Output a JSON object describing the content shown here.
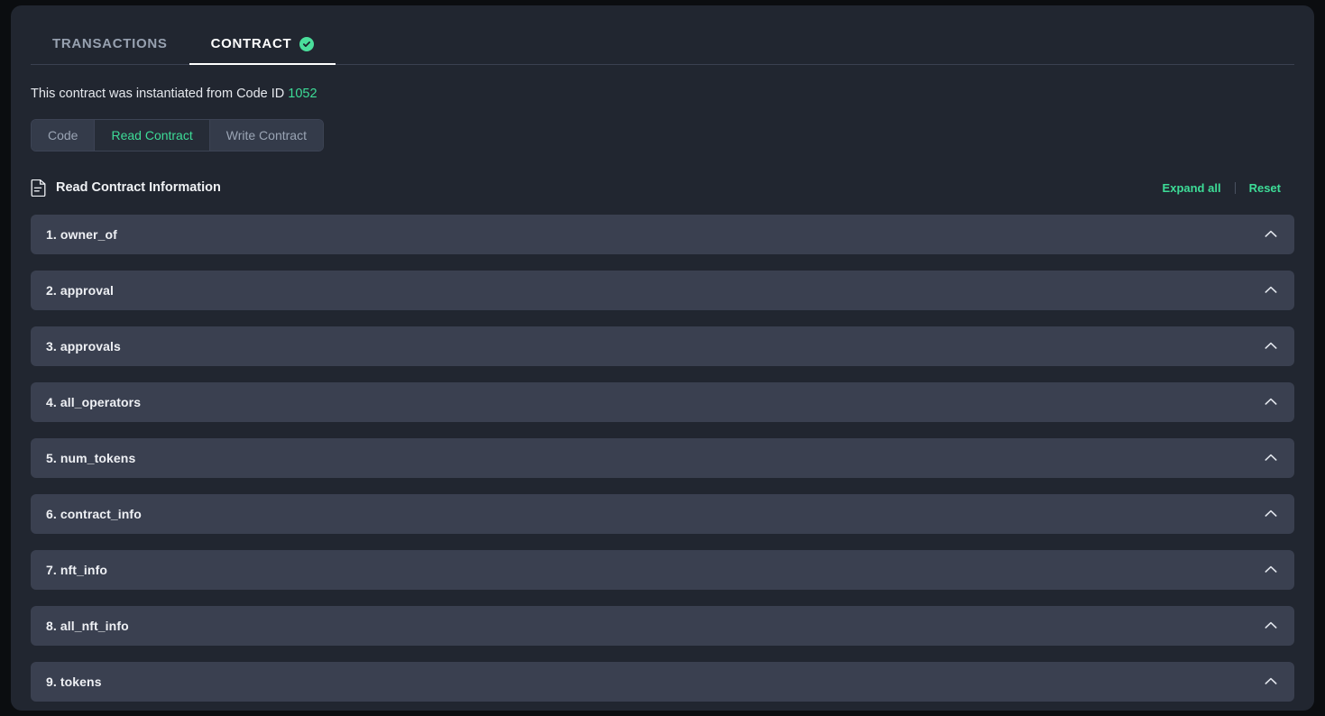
{
  "tabs": [
    {
      "label": "TRANSACTIONS",
      "active": false,
      "verified": false
    },
    {
      "label": "CONTRACT",
      "active": true,
      "verified": true
    }
  ],
  "instantiated": {
    "prefix": "This contract was instantiated from Code ID",
    "code_id": "1052"
  },
  "segmented": {
    "buttons": [
      {
        "label": "Code",
        "selected": false
      },
      {
        "label": "Read Contract",
        "selected": true
      },
      {
        "label": "Write Contract",
        "selected": false
      }
    ]
  },
  "section": {
    "icon": "document-icon",
    "title": "Read Contract Information",
    "expand_all_label": "Expand all",
    "reset_label": "Reset"
  },
  "accordion": {
    "items": [
      {
        "label": "1. owner_of",
        "state": "expanded",
        "icon": "chevron-up-icon"
      },
      {
        "label": "2. approval",
        "state": "expanded",
        "icon": "chevron-up-icon"
      },
      {
        "label": "3. approvals",
        "state": "expanded",
        "icon": "chevron-up-icon"
      },
      {
        "label": "4. all_operators",
        "state": "expanded",
        "icon": "chevron-up-icon"
      },
      {
        "label": "5. num_tokens",
        "state": "expanded",
        "icon": "chevron-up-icon"
      },
      {
        "label": "6. contract_info",
        "state": "expanded",
        "icon": "chevron-up-icon"
      },
      {
        "label": "7. nft_info",
        "state": "expanded",
        "icon": "chevron-up-icon"
      },
      {
        "label": "8. all_nft_info",
        "state": "expanded",
        "icon": "chevron-up-icon"
      },
      {
        "label": "9. tokens",
        "state": "expanded",
        "icon": "chevron-up-icon"
      }
    ]
  },
  "colors": {
    "page_background": "#0b0d10",
    "card_background": "#212630",
    "row_background": "#3a4050",
    "accent_teal": "#3ddc97",
    "verified_green": "#4ade9b",
    "active_tab_text": "#ffffff",
    "inactive_tab_text": "#97a1b0",
    "body_text": "#e6e9ee"
  }
}
